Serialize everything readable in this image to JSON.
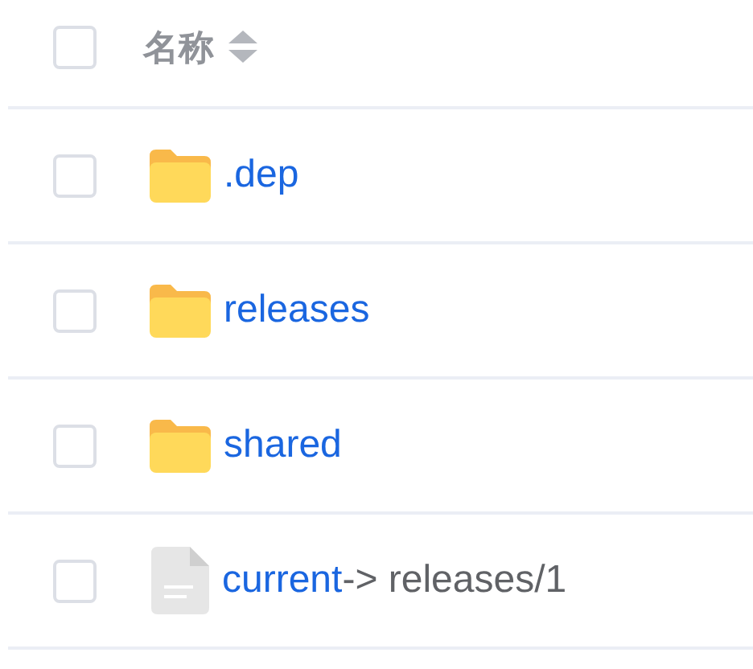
{
  "header": {
    "label": "名称",
    "checked": false
  },
  "rows": [
    {
      "kind": "folder",
      "name": ".dep",
      "checked": false
    },
    {
      "kind": "folder",
      "name": "releases",
      "checked": false
    },
    {
      "kind": "folder",
      "name": "shared",
      "checked": false
    },
    {
      "kind": "file",
      "name": "current",
      "target": "-> releases/1",
      "checked": false
    }
  ]
}
